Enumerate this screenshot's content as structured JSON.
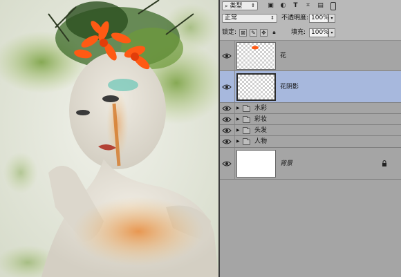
{
  "layers_panel": {
    "filter": {
      "kind": "类型"
    },
    "blend_mode": "正常",
    "opacity": {
      "label": "不透明度:",
      "value": "100%"
    },
    "lock": {
      "label": "锁定:"
    },
    "fill": {
      "label": "填充:",
      "value": "100%"
    },
    "layers": [
      {
        "name": "花",
        "type": "pixel",
        "visible": true,
        "selected": false
      },
      {
        "name": "花阴影",
        "type": "pixel",
        "visible": true,
        "selected": true
      },
      {
        "name": "水彩",
        "type": "group",
        "visible": true,
        "collapsed": true
      },
      {
        "name": "彩妆",
        "type": "group",
        "visible": true,
        "collapsed": true
      },
      {
        "name": "头发",
        "type": "group",
        "visible": true,
        "collapsed": true
      },
      {
        "name": "人物",
        "type": "group",
        "visible": true,
        "collapsed": true
      },
      {
        "name": "背景",
        "type": "background",
        "visible": true,
        "locked": true
      }
    ]
  },
  "icons": {
    "filter_search": "search-icon",
    "filter_types": [
      "image-filter-icon",
      "adjustment-filter-icon",
      "type-filter-icon",
      "shape-filter-icon",
      "smart-object-filter-icon",
      "filter-toggle-icon"
    ],
    "lock_types": [
      "lock-transparent-icon",
      "lock-image-icon",
      "lock-position-icon",
      "lock-all-icon"
    ]
  },
  "colors": {
    "panel_bg": "#a5a5a5",
    "selected_layer": "#a7b8dd",
    "flower_orange": "#ff5a14"
  }
}
